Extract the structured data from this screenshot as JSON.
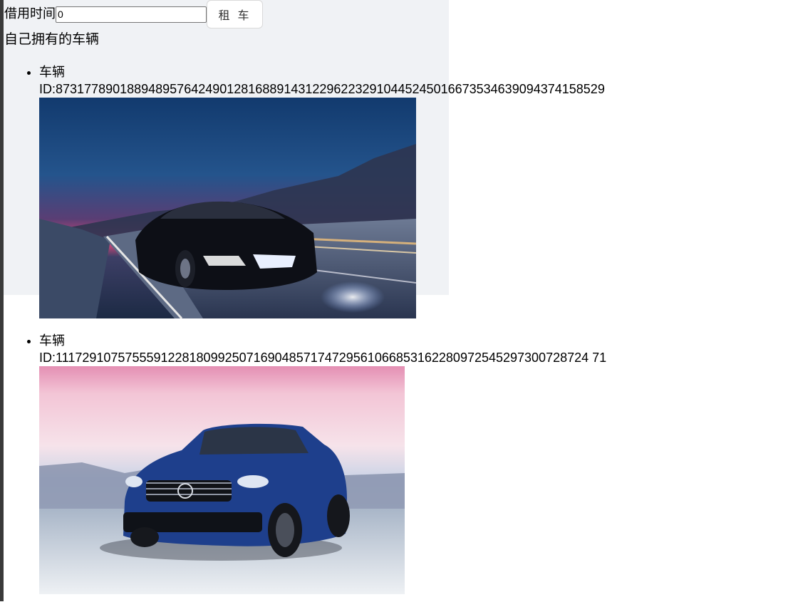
{
  "rent": {
    "label": "借用时间",
    "input_value": "0",
    "button_label": "租 车"
  },
  "owned_title": "自己拥有的车辆",
  "cars": [
    {
      "label": "车辆",
      "id_text": "ID:87317789018894895764249012816889143122962232910445245016673534639094374158529",
      "image": "night-road-black-sedan"
    },
    {
      "label": "车辆",
      "id_text": "ID:111729107575559122818099250716904857174729561066853162280972545297300728724 71",
      "image": "blue-suv-dusk"
    }
  ]
}
